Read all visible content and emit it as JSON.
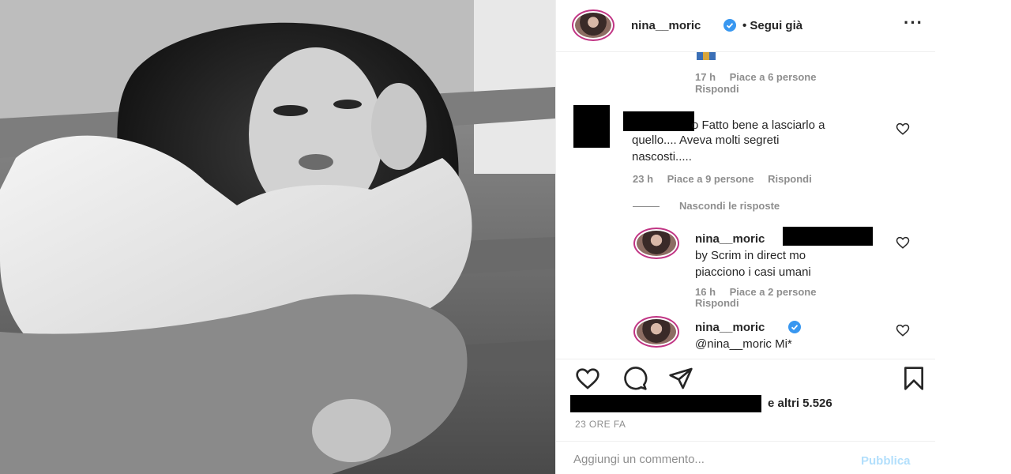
{
  "post": {
    "author": "nina__moric",
    "follow_status": "• Segui già",
    "more_icon": "more-options-icon"
  },
  "comments": [
    {
      "meta": {
        "time": "17 h",
        "likes": "Piace a 6 persone",
        "reply": "Rispondi"
      }
    },
    {
      "text_line1": "o Fatto bene a lasciarlo a",
      "text_line2": "quello.... Aveva molti segreti",
      "text_line3": "nascosti.....",
      "meta": {
        "time": "23 h",
        "likes": "Piace a 9 persone",
        "reply": "Rispondi"
      },
      "hide_replies": "Nascondi le risposte"
    }
  ],
  "replies": [
    {
      "username": "nina__moric",
      "text_line1": "by Scrim in direct mo",
      "text_line2": "piacciono i casi umani",
      "meta": {
        "time": "16 h",
        "likes": "Piace a 2 persone",
        "reply": "Rispondi"
      }
    },
    {
      "username": "nina__moric",
      "text": "@nina__moric Mi*"
    }
  ],
  "likes_text": "e altri 5.526",
  "time_ago": "23 ORE FA",
  "add_comment": {
    "placeholder": "Aggiungi un commento...",
    "publish_label": "Pubblica"
  },
  "colors": {
    "verified": "#3897f0",
    "publish_disabled": "#b2dffc",
    "meta_gray": "#8e8e8e"
  }
}
